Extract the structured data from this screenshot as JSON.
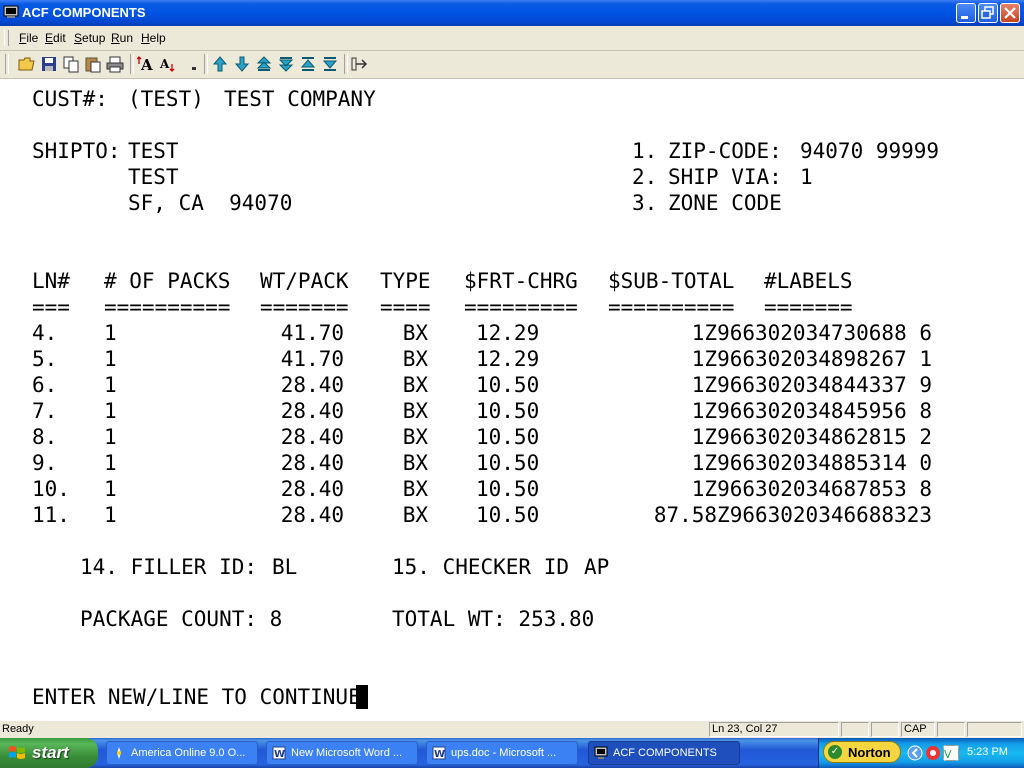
{
  "window": {
    "title": "ACF COMPONENTS"
  },
  "menu": [
    "File",
    "Edit",
    "Setup",
    "Run",
    "Help"
  ],
  "menu_underline": [
    "F",
    "E",
    "S",
    "R",
    "H"
  ],
  "toolbar": {
    "icons": [
      "open-folder-icon",
      "save-icon",
      "copy-icon",
      "paste-icon",
      "print-icon",
      "font-larger-icon",
      "font-smaller-icon",
      "small-dot-icon",
      "arrow-up-icon",
      "arrow-down-icon",
      "page-up-icon",
      "page-down-icon",
      "top-icon",
      "bottom-icon",
      "connect-icon"
    ]
  },
  "screen": {
    "cust_label": "CUST#:",
    "cust_code": "(TEST)",
    "cust_name": "TEST COMPANY",
    "shipto_label": "SHIPTO:",
    "shipto_lines": [
      "TEST",
      "TEST",
      "SF, CA  94070"
    ],
    "fields": [
      {
        "num": "1.",
        "label": "ZIP-CODE:",
        "value": "94070 99999"
      },
      {
        "num": "2.",
        "label": "SHIP VIA:",
        "value": "1"
      },
      {
        "num": "3.",
        "label": "ZONE CODE",
        "value": ""
      }
    ],
    "headers": [
      "LN#",
      "# OF PACKS",
      "WT/PACK",
      "TYPE",
      "$FRT-CHRG",
      "$SUB-TOTAL",
      "#LABELS"
    ],
    "underlines": [
      "===",
      "==========",
      "=======",
      "====",
      "=========",
      "==========",
      "======="
    ],
    "rows": [
      {
        "ln": "4.",
        "packs": "1",
        "wt": "41.70",
        "type": "BX",
        "frt": "12.29",
        "labels": "1Z966302034730688 6"
      },
      {
        "ln": "5.",
        "packs": "1",
        "wt": "41.70",
        "type": "BX",
        "frt": "12.29",
        "labels": "1Z966302034898267 1"
      },
      {
        "ln": "6.",
        "packs": "1",
        "wt": "28.40",
        "type": "BX",
        "frt": "10.50",
        "labels": "1Z966302034844337 9"
      },
      {
        "ln": "7.",
        "packs": "1",
        "wt": "28.40",
        "type": "BX",
        "frt": "10.50",
        "labels": "1Z966302034845956 8"
      },
      {
        "ln": "8.",
        "packs": "1",
        "wt": "28.40",
        "type": "BX",
        "frt": "10.50",
        "labels": "1Z966302034862815 2"
      },
      {
        "ln": "9.",
        "packs": "1",
        "wt": "28.40",
        "type": "BX",
        "frt": "10.50",
        "labels": "1Z966302034885314 0"
      },
      {
        "ln": "10.",
        "packs": "1",
        "wt": "28.40",
        "type": "BX",
        "frt": "10.50",
        "labels": "1Z966302034687853 8"
      },
      {
        "ln": "11.",
        "packs": "1",
        "wt": "28.40",
        "type": "BX",
        "frt": "10.50",
        "labels": "87.58Z9663020346688323"
      }
    ],
    "filler_label": "14. FILLER ID:",
    "filler_value": "BL",
    "checker_label": "15. CHECKER ID",
    "checker_value": "AP",
    "package_count": "PACKAGE COUNT: 8",
    "total_wt": "TOTAL WT: 253.80",
    "prompt": "ENTER NEW/LINE TO CONTINUE"
  },
  "status": {
    "ready": "Ready",
    "position": "Ln 23, Col 27",
    "cap": "CAP"
  },
  "taskbar": {
    "start": "start",
    "tasks": [
      {
        "label": "America Online 9.0 O...",
        "icon": "aol-icon",
        "active": false
      },
      {
        "label": "New Microsoft Word ...",
        "icon": "word-icon",
        "active": false
      },
      {
        "label": "ups.doc - Microsoft ...",
        "icon": "word-icon",
        "active": false
      },
      {
        "label": "ACF COMPONENTS",
        "icon": "terminal-icon",
        "active": true
      }
    ],
    "norton": "Norton",
    "clock": "5:23 PM"
  }
}
